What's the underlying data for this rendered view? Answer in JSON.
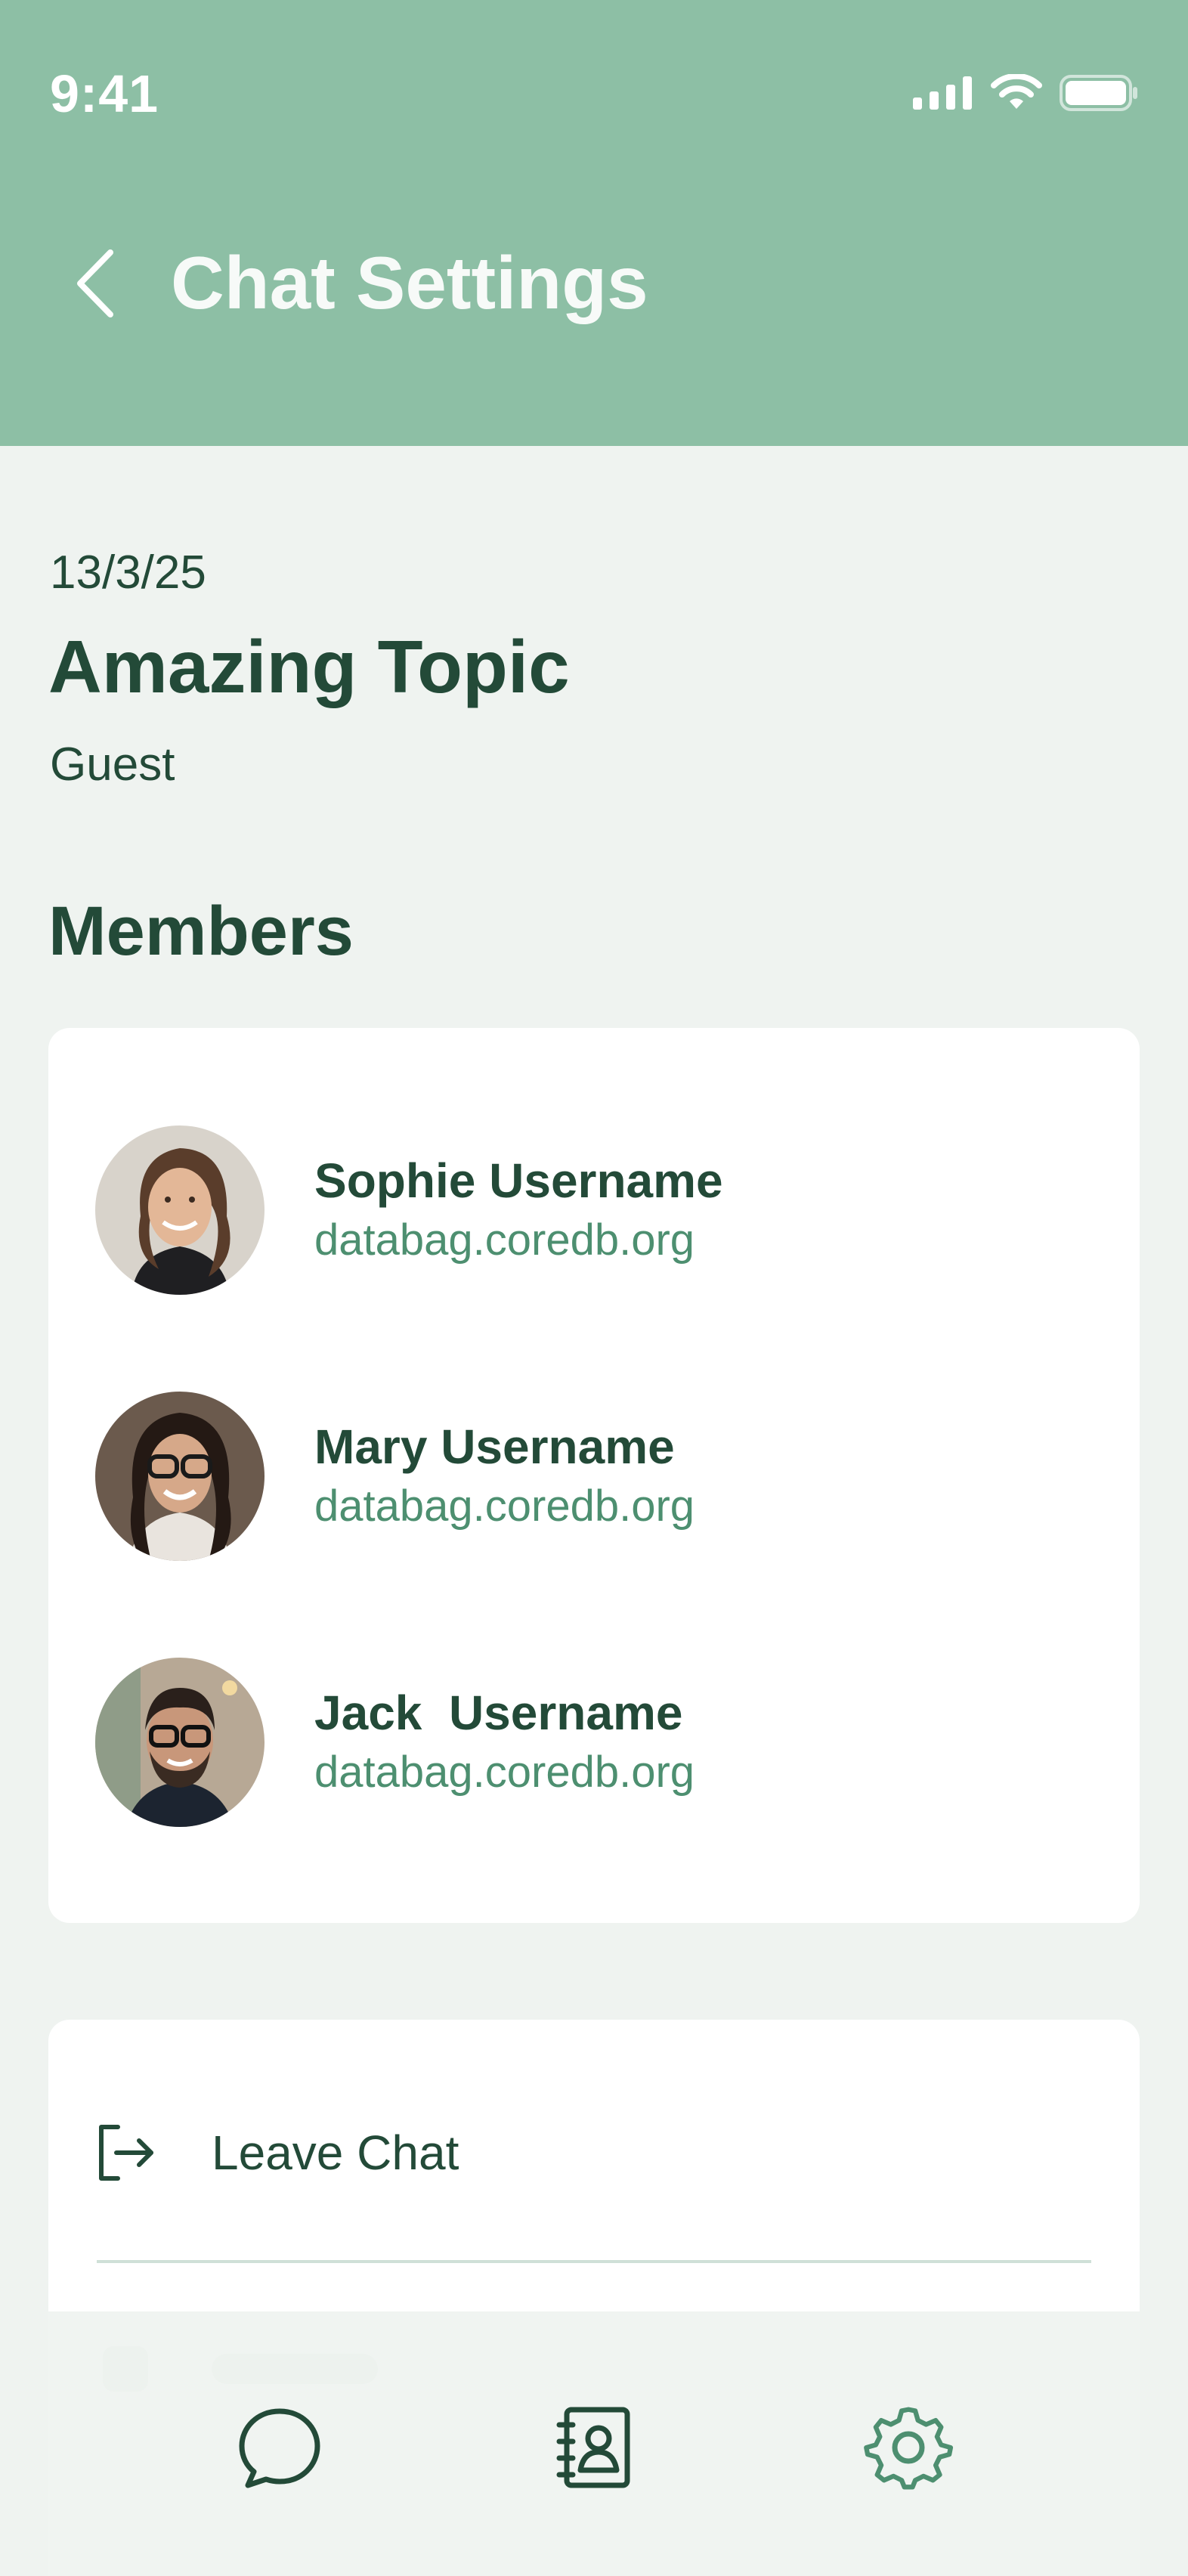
{
  "status_bar": {
    "time": "9:41"
  },
  "header": {
    "title": "Chat Settings"
  },
  "topic": {
    "date": "13/3/25",
    "name": "Amazing Topic",
    "role": "Guest"
  },
  "members": {
    "heading": "Members",
    "items": [
      {
        "name": "Sophie Username",
        "host": "databag.coredb.org"
      },
      {
        "name": "Mary Username",
        "host": "databag.coredb.org"
      },
      {
        "name": "Jack  Username",
        "host": "databag.coredb.org"
      }
    ]
  },
  "actions": {
    "leave_label": "Leave Chat"
  },
  "colors": {
    "header": "#8dbfa5",
    "background": "#eff3f0",
    "text": "#234a38",
    "accent": "#4d8f70"
  },
  "nav": {
    "icons": [
      "chat-bubble-icon",
      "contacts-book-icon",
      "gear-icon"
    ],
    "active": "gear-icon"
  }
}
